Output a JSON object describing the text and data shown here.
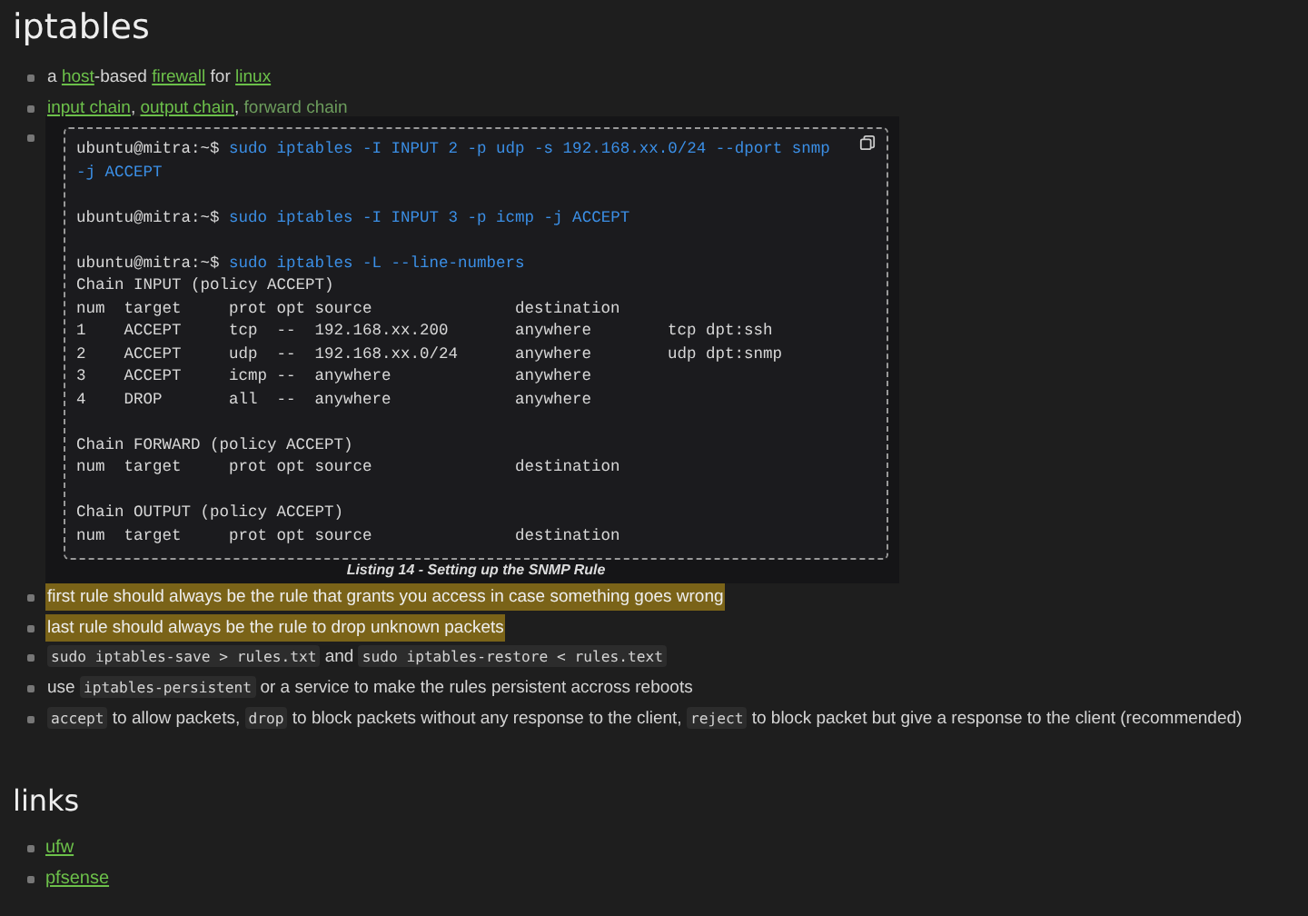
{
  "title": "iptables",
  "bullets": [
    {
      "kind": "text",
      "segments": [
        {
          "kind": "text",
          "text": "a "
        },
        {
          "kind": "link",
          "text": "host"
        },
        {
          "kind": "text",
          "text": "-based "
        },
        {
          "kind": "link",
          "text": "firewall"
        },
        {
          "kind": "text",
          "text": " for "
        },
        {
          "kind": "link",
          "text": "linux"
        }
      ]
    },
    {
      "kind": "text",
      "segments": [
        {
          "kind": "link",
          "text": "input chain"
        },
        {
          "kind": "link",
          "lead": ", ",
          "text": "output chain"
        },
        {
          "kind": "unlinked",
          "lead": ", ",
          "text": "forward chain"
        }
      ]
    },
    {
      "kind": "listing",
      "listing": {
        "caption": "Listing 14 - Setting up the SNMP Rule",
        "lines": [
          {
            "kind": "command",
            "prompt": "ubuntu@mitra:~$",
            "command": "sudo iptables -I INPUT 2 -p udp -s 192.168.xx.0/24 --dport snmp -j ACCEPT"
          },
          {
            "kind": "blank"
          },
          {
            "kind": "command",
            "prompt": "ubuntu@mitra:~$",
            "command": "sudo iptables -I INPUT 3 -p icmp -j ACCEPT"
          },
          {
            "kind": "blank"
          },
          {
            "kind": "command",
            "prompt": "ubuntu@mitra:~$",
            "command": "sudo iptables -L --line-numbers"
          },
          {
            "kind": "output",
            "text": "Chain INPUT (policy ACCEPT)"
          },
          {
            "kind": "output",
            "text": "num  target     prot opt source               destination"
          },
          {
            "kind": "output",
            "text": "1    ACCEPT     tcp  --  192.168.xx.200       anywhere        tcp dpt:ssh"
          },
          {
            "kind": "output",
            "text": "2    ACCEPT     udp  --  192.168.xx.0/24      anywhere        udp dpt:snmp"
          },
          {
            "kind": "output",
            "text": "3    ACCEPT     icmp --  anywhere             anywhere"
          },
          {
            "kind": "output",
            "text": "4    DROP       all  --  anywhere             anywhere"
          },
          {
            "kind": "blank"
          },
          {
            "kind": "output",
            "text": "Chain FORWARD (policy ACCEPT)"
          },
          {
            "kind": "output",
            "text": "num  target     prot opt source               destination"
          },
          {
            "kind": "blank"
          },
          {
            "kind": "output",
            "text": "Chain OUTPUT (policy ACCEPT)"
          },
          {
            "kind": "output",
            "text": "num  target     prot opt source               destination"
          }
        ]
      }
    },
    {
      "kind": "highlight",
      "segments": [
        {
          "kind": "text",
          "text": "first rule should always be the rule that grants you access in case something goes wrong"
        }
      ]
    },
    {
      "kind": "highlight",
      "segments": [
        {
          "kind": "text",
          "text": "last rule should always be the rule to drop unknown packets"
        }
      ]
    },
    {
      "kind": "text",
      "segments": [
        {
          "kind": "code",
          "text": "sudo iptables-save > rules.txt"
        },
        {
          "kind": "text",
          "text": " and "
        },
        {
          "kind": "code",
          "text": "sudo iptables-restore < rules.text"
        }
      ]
    },
    {
      "kind": "text",
      "segments": [
        {
          "kind": "text",
          "text": "use "
        },
        {
          "kind": "code",
          "text": "iptables-persistent"
        },
        {
          "kind": "text",
          "text": " or a service to make the rules persistent accross reboots"
        }
      ]
    },
    {
      "kind": "text",
      "segments": [
        {
          "kind": "code",
          "text": "accept"
        },
        {
          "kind": "text",
          "text": " to allow packets, "
        },
        {
          "kind": "code",
          "text": "drop"
        },
        {
          "kind": "text",
          "text": " to block packets without any response to the client, "
        },
        {
          "kind": "code",
          "text": "reject"
        },
        {
          "kind": "text",
          "text": " to block packet but give a response to the client (recommended)"
        }
      ]
    }
  ],
  "links_section": {
    "title": "links",
    "items": [
      {
        "text": "ufw"
      },
      {
        "text": "pfsense"
      }
    ]
  }
}
